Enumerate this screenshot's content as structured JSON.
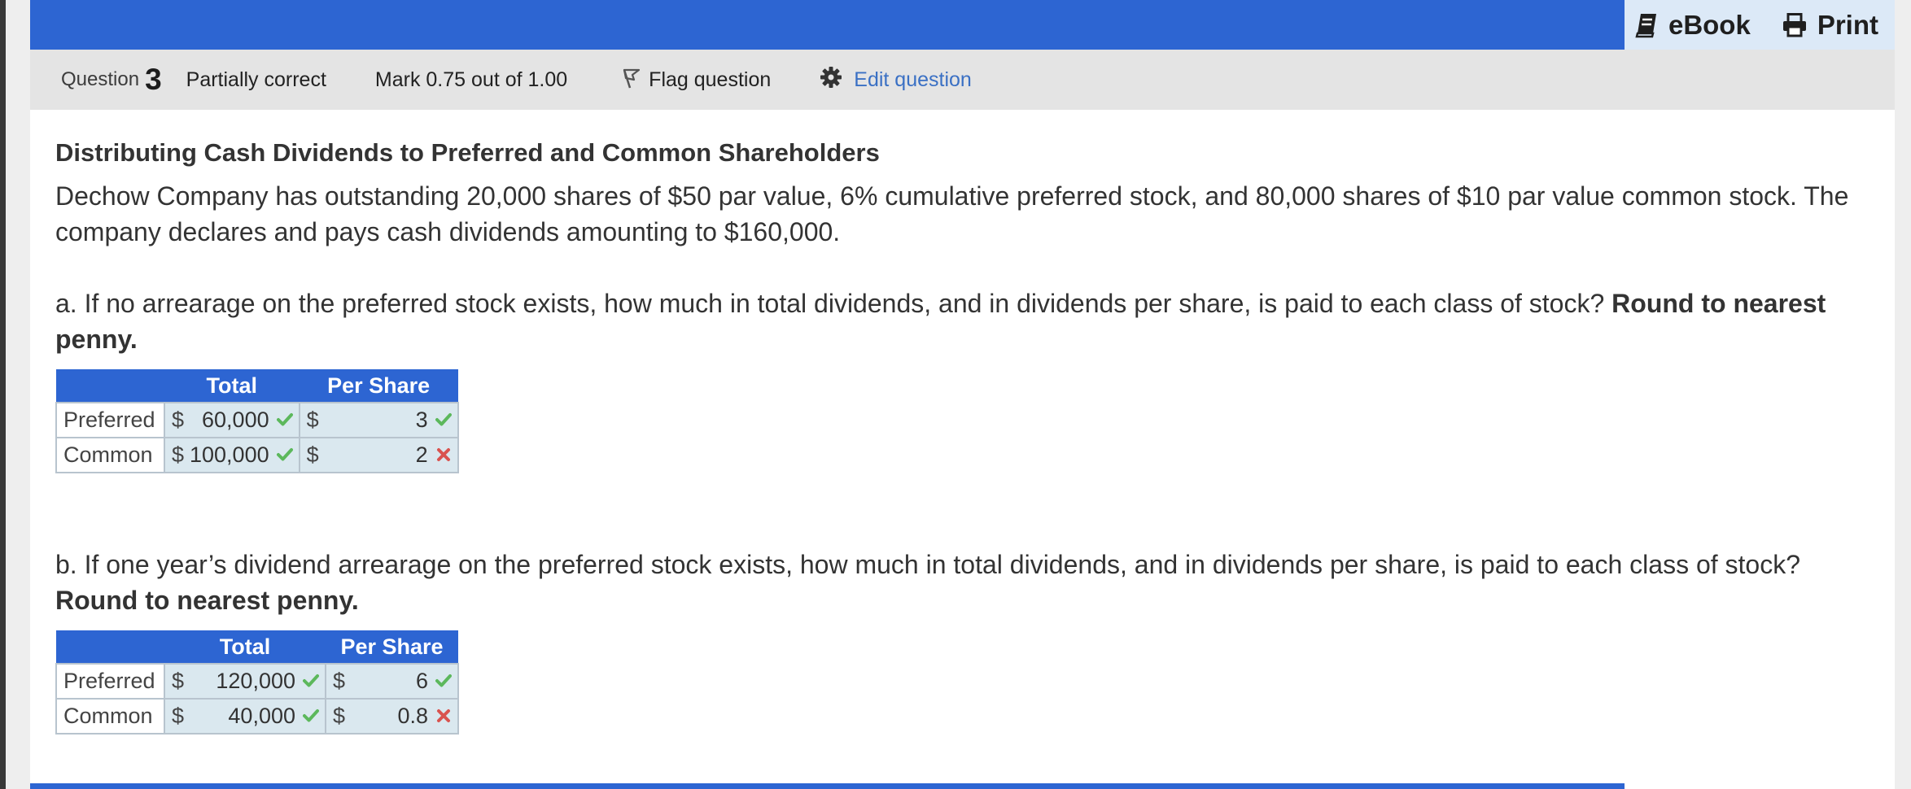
{
  "colors": {
    "brand_blue": "#2d65d2",
    "correct": "#5cb85c",
    "incorrect": "#d9534f",
    "cell_bg": "#dae8ef"
  },
  "top_tools": {
    "ebook_label": "eBook",
    "ebook_icon": "book-icon",
    "print_label": "Print",
    "print_icon": "printer-icon"
  },
  "question_info": {
    "question_label": "Question",
    "question_number": "3",
    "state": "Partially correct",
    "mark": "Mark 0.75 out of 1.00",
    "flag_label": "Flag question",
    "flag_icon": "flag-icon",
    "edit_label": "Edit question",
    "edit_icon": "gear-icon"
  },
  "question": {
    "title": "Distributing Cash Dividends to Preferred and Common Shareholders",
    "intro": "Dechow Company has outstanding 20,000 shares of $50 par value, 6% cumulative preferred stock, and 80,000 shares of $10 par value common stock. The company declares and pays cash dividends amounting to $160,000.",
    "part_a": {
      "text": "a. If no arrearage on the preferred stock exists, how much in total dividends, and in dividends per share, is paid to each class of stock?",
      "emphasis": "Round to nearest penny.",
      "headers": [
        "Total",
        "Per Share"
      ],
      "rows": [
        {
          "label": "Preferred",
          "currency1": "$",
          "total": "60,000",
          "total_status": "correct",
          "currency2": "$",
          "per_share": "3",
          "per_share_status": "correct"
        },
        {
          "label": "Common",
          "currency1": "$",
          "total": "100,000",
          "total_status": "correct",
          "currency2": "$",
          "per_share": "2",
          "per_share_status": "incorrect"
        }
      ]
    },
    "part_b": {
      "text": "b. If one year’s dividend arrearage on the preferred stock exists, how much in total dividends, and in dividends per share, is paid to each class of stock?",
      "emphasis": "Round to nearest penny.",
      "headers": [
        "Total",
        "Per Share"
      ],
      "rows": [
        {
          "label": "Preferred",
          "currency1": "$",
          "total": "120,000",
          "total_status": "correct",
          "currency2": "$",
          "per_share": "6",
          "per_share_status": "correct"
        },
        {
          "label": "Common",
          "currency1": "$",
          "total": "40,000",
          "total_status": "correct",
          "currency2": "$",
          "per_share": "0.8",
          "per_share_status": "incorrect"
        }
      ]
    }
  }
}
